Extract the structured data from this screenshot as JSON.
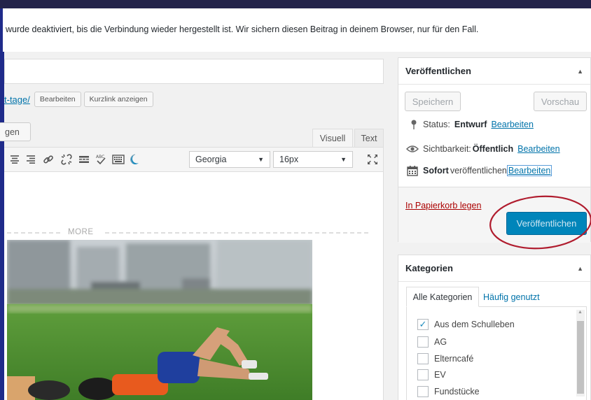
{
  "notice": {
    "text": "wurde deaktiviert, bis die Verbindung wieder hergestellt ist. Wir sichern diesen Beitrag in deinem Browser, nur für den Fall."
  },
  "permalink": {
    "slug": "t-tage/",
    "edit_label": "Bearbeiten",
    "shortlink_label": "Kurzlink anzeigen"
  },
  "editor": {
    "media_button": "gen",
    "tab_visual": "Visuell",
    "tab_text": "Text",
    "font_select": "Georgia",
    "size_select": "16px",
    "more_label": "MORE"
  },
  "publish": {
    "title": "Veröffentlichen",
    "save_label": "Speichern",
    "preview_label": "Vorschau",
    "status_label": "Status:",
    "status_value": "Entwurf",
    "status_edit": "Bearbeiten",
    "visibility_label": "Sichtbarkeit:",
    "visibility_value": "Öffentlich",
    "visibility_edit": "Bearbeiten",
    "schedule_value": "Sofort",
    "schedule_label": "veröffentlichen",
    "schedule_edit": "Bearbeiten",
    "trash_label": "In Papierkorb legen",
    "publish_button": "Veröffentlichen",
    "button_color": "#0085ba",
    "highlight_color": "#b01c2e"
  },
  "categories": {
    "title": "Kategorien",
    "tab_all": "Alle Kategorien",
    "tab_frequent": "Häufig genutzt",
    "items": [
      {
        "label": "Aus dem Schulleben",
        "checked": true
      },
      {
        "label": "AG",
        "checked": false
      },
      {
        "label": "Elterncafé",
        "checked": false
      },
      {
        "label": "EV",
        "checked": false
      },
      {
        "label": "Fundstücke",
        "checked": false
      }
    ]
  },
  "icons": {
    "toolbar": [
      "align-center-icon",
      "align-right-icon",
      "link-icon",
      "unlink-icon",
      "read-more-icon",
      "spellcheck-icon",
      "keyboard-icon",
      "moon-icon"
    ],
    "fullscreen": "fullscreen-icon",
    "status": "pin-icon",
    "visibility": "eye-icon",
    "schedule": "calendar-icon"
  }
}
